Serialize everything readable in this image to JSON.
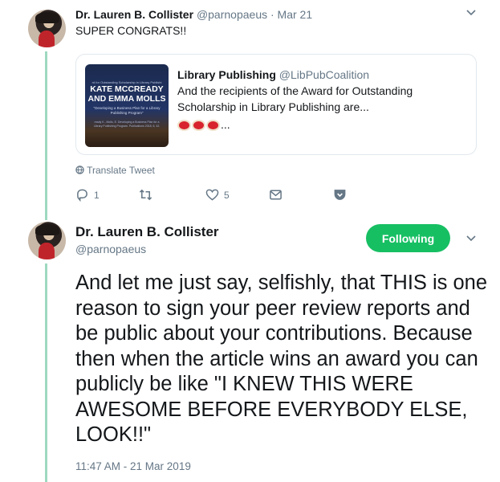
{
  "tweet1": {
    "author_name": "Dr. Lauren B. Collister",
    "author_handle": "@parnopaeus",
    "date": "· Mar 21",
    "text": "SUPER CONGRATS!!",
    "quoted": {
      "name": "Library Publishing",
      "handle": "@LibPubCoalition",
      "text": "And the recipients of the Award for Outstanding Scholarship in Library Publishing are...",
      "ellipsis": "...",
      "image": {
        "small_text": "rd for Outstanding Scholarship in Library Publishi",
        "headline_1": "KATE MCCREADY",
        "headline_2": "AND EMMA MOLLS",
        "subtitle": "\"Developing a Business Plan for a Library Publishing Program\"",
        "caption": "ready K., Molls, E. Developing a Business Plan for a Library Publishing Program. Publications 2018, 6, 42."
      }
    },
    "translate": "Translate Tweet",
    "actions": {
      "reply_count": "1",
      "retweet_count": "",
      "like_count": "5"
    }
  },
  "tweet2": {
    "author_name": "Dr. Lauren B. Collister",
    "author_handle": "@parnopaeus",
    "follow_label": "Following",
    "text": "And let me just say, selfishly, that THIS is one reason to sign your peer review reports and be public about your contributions. Because then when the article wins an award you can publicly be like \"I KNEW THIS WERE AWESOME BEFORE EVERYBODY ELSE, LOOK!!\"",
    "timestamp": "11:47 AM - 21 Mar 2019"
  },
  "colors": {
    "thread_line": "#9ed9c0",
    "following_button": "#17bf63",
    "secondary_text": "#657786"
  },
  "icons": [
    "chevron-down-icon",
    "globe-icon",
    "reply-icon",
    "retweet-icon",
    "like-icon",
    "message-icon",
    "pocket-icon"
  ]
}
